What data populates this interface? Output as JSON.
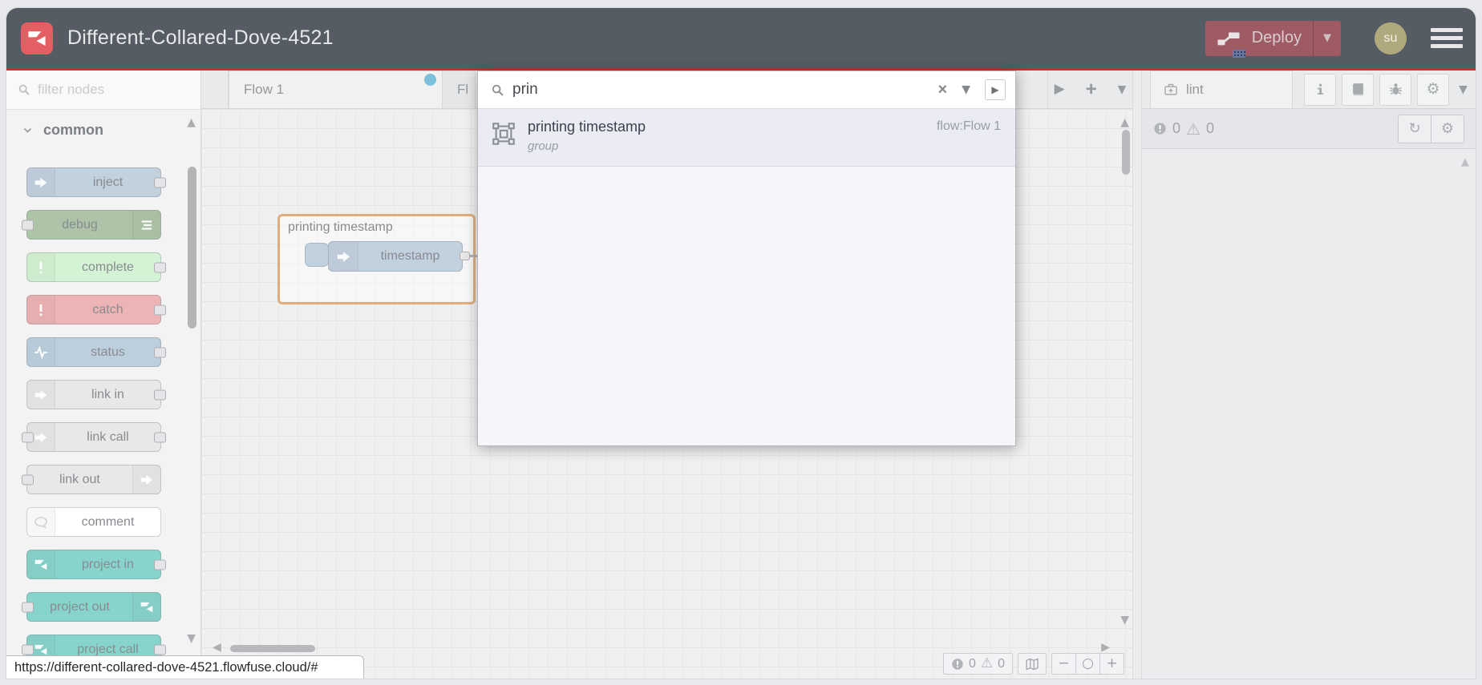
{
  "header": {
    "title": "Different-Collared-Dove-4521",
    "deploy_label": "Deploy",
    "avatar_initials": "su",
    "colors": {
      "header_bg": "#565c63",
      "accent_red": "#cf2d2d",
      "deploy_bg": "#9e5b63",
      "logo_bg": "#e35f63",
      "avatar_bg": "#b1a97e"
    }
  },
  "palette": {
    "filter_placeholder": "filter nodes",
    "category_label": "common",
    "nodes": [
      {
        "label": "inject",
        "color": "#a6bbcf",
        "icon": "arrow-right",
        "layout": "in"
      },
      {
        "label": "debug",
        "color": "#87a980",
        "icon": "debug-lines",
        "layout": "out"
      },
      {
        "label": "complete",
        "color": "#c0edc0",
        "icon": "exclamation",
        "layout": "in"
      },
      {
        "label": "catch",
        "color": "#e49191",
        "icon": "exclamation",
        "layout": "in"
      },
      {
        "label": "status",
        "color": "#9db9cd",
        "icon": "pulse",
        "layout": "in"
      },
      {
        "label": "link in",
        "color": "#dddddd",
        "icon": "arrow-right",
        "layout": "in"
      },
      {
        "label": "link call",
        "color": "#dddddd",
        "icon": "arrow-right",
        "layout": "both"
      },
      {
        "label": "link out",
        "color": "#dddddd",
        "icon": "arrow-right",
        "layout": "out"
      },
      {
        "label": "comment",
        "color": "#ffffff",
        "icon": "bubble",
        "layout": "none",
        "iconColor": "#b9bbbe"
      },
      {
        "label": "project in",
        "color": "#4ec0b4",
        "icon": "ff-logo",
        "layout": "in"
      },
      {
        "label": "project out",
        "color": "#4ec0b4",
        "icon": "ff-logo",
        "layout": "out"
      },
      {
        "label": "project call",
        "color": "#4ec0b4",
        "icon": "ff-logo",
        "layout": "both"
      }
    ]
  },
  "tabs": {
    "flow1": "Flow 1",
    "flow2_partial": "Fl",
    "changed_dot_color": "#3fa4cc"
  },
  "canvas": {
    "group_label": "printing timestamp",
    "group_color": "#d2883e",
    "node_label": "timestamp",
    "footer": {
      "errors": "0",
      "warnings": "0"
    }
  },
  "search": {
    "query": "prin",
    "result": {
      "title": "printing timestamp",
      "type": "group",
      "flow": "flow:Flow 1"
    }
  },
  "sidebar": {
    "tab_label": "lint",
    "errors": "0",
    "warnings": "0"
  },
  "statusbar": {
    "url": "https://different-collared-dove-4521.flowfuse.cloud/#"
  }
}
